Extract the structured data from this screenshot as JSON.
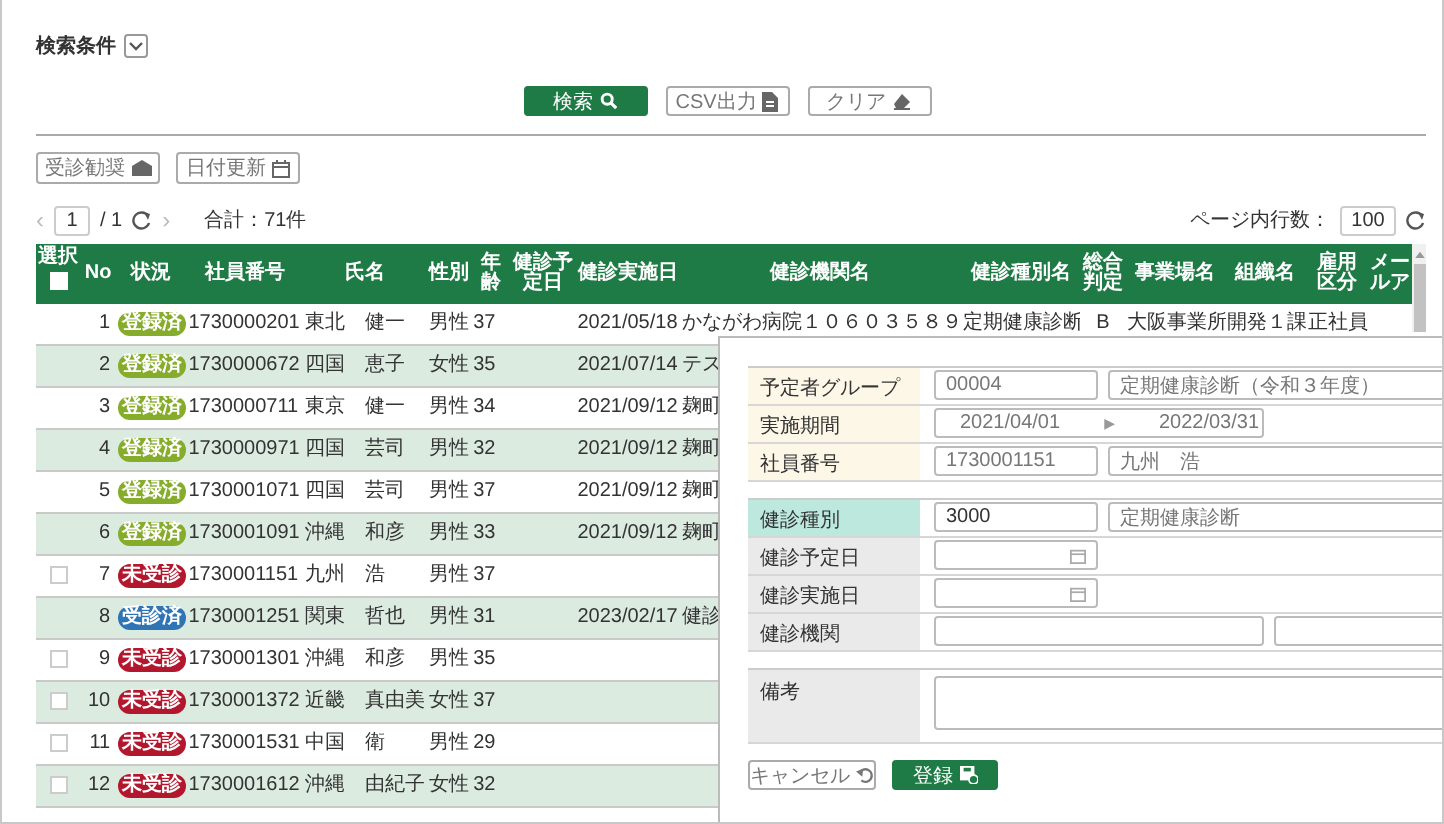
{
  "search_conditions": {
    "label": "検索条件",
    "expanded": false
  },
  "actions": [
    {
      "label": "検索",
      "kind": "search"
    },
    {
      "label": "CSV出力",
      "kind": "csv"
    },
    {
      "label": "クリア",
      "kind": "clear"
    }
  ],
  "tools": [
    {
      "label": "受診勧奨",
      "kind": "mail"
    },
    {
      "label": "日付更新",
      "kind": "calendar"
    }
  ],
  "pagination": {
    "prev": "‹",
    "page": "1",
    "total_pages": "/ 1",
    "next": "›",
    "total": "合計：71件",
    "rows_label": "ページ内行数：",
    "rows_per_page": "100"
  },
  "table": {
    "select_all": {
      "label": "選択",
      "checked": false
    },
    "columns": [
      "No",
      "状況",
      "社員番号",
      "氏名",
      "性別",
      "年齢",
      "健診予定日",
      "健診実施日",
      "健診機関名",
      "健診種別名",
      "総合判定",
      "事業場名",
      "組織名",
      "雇用区分",
      "メールア"
    ],
    "rows": [
      {
        "no": "1",
        "status": {
          "label": "登録済",
          "color": "#86ac2c"
        },
        "id": "1730000201",
        "name": "東北　健一",
        "gender": "男性",
        "age": "37",
        "exam_date": "2021/05/18",
        "clinic": "かながわ病院１０６０３５８９",
        "exam_type": "定期健康診断",
        "judgement": "B",
        "site": "大阪事業所",
        "org": "開発１課",
        "employment": "正社員"
      },
      {
        "no": "2",
        "status": {
          "label": "登録済",
          "color": "#86ac2c"
        },
        "id": "1730000672",
        "name": "四国　恵子",
        "gender": "女性",
        "age": "35",
        "exam_date": "2021/07/14",
        "clinic": "テス"
      },
      {
        "no": "3",
        "status": {
          "label": "登録済",
          "color": "#86ac2c"
        },
        "id": "1730000711",
        "name": "東京　健一",
        "gender": "男性",
        "age": "34",
        "exam_date": "2021/09/12",
        "clinic": "麹町"
      },
      {
        "no": "4",
        "status": {
          "label": "登録済",
          "color": "#86ac2c"
        },
        "id": "1730000971",
        "name": "四国　芸司",
        "gender": "男性",
        "age": "32",
        "exam_date": "2021/09/12",
        "clinic": "麹町"
      },
      {
        "no": "5",
        "status": {
          "label": "登録済",
          "color": "#86ac2c"
        },
        "id": "1730001071",
        "name": "四国　芸司",
        "gender": "男性",
        "age": "37",
        "exam_date": "2021/09/12",
        "clinic": "麹町"
      },
      {
        "no": "6",
        "status": {
          "label": "登録済",
          "color": "#86ac2c"
        },
        "id": "1730001091",
        "name": "沖縄　和彦",
        "gender": "男性",
        "age": "33",
        "exam_date": "2021/09/12",
        "clinic": "麹町"
      },
      {
        "no": "7",
        "status": {
          "label": "未受診",
          "color": "#b3172e"
        },
        "checkbox": {
          "checked": false
        },
        "id": "1730001151",
        "name": "九州　浩",
        "gender": "男性",
        "age": "37"
      },
      {
        "no": "8",
        "status": {
          "label": "受診済",
          "color": "#2f74b5"
        },
        "id": "1730001251",
        "name": "関東　哲也",
        "gender": "男性",
        "age": "31",
        "exam_date": "2023/02/17",
        "clinic": "健診"
      },
      {
        "no": "9",
        "status": {
          "label": "未受診",
          "color": "#b3172e"
        },
        "checkbox": {
          "checked": false
        },
        "id": "1730001301",
        "name": "沖縄　和彦",
        "gender": "男性",
        "age": "35"
      },
      {
        "no": "10",
        "status": {
          "label": "未受診",
          "color": "#b3172e"
        },
        "checkbox": {
          "checked": false
        },
        "id": "1730001372",
        "name": "近畿　真由美",
        "gender": "女性",
        "age": "37"
      },
      {
        "no": "11",
        "status": {
          "label": "未受診",
          "color": "#b3172e"
        },
        "checkbox": {
          "checked": false
        },
        "id": "1730001531",
        "name": "中国　衛",
        "gender": "男性",
        "age": "29"
      },
      {
        "no": "12",
        "status": {
          "label": "未受診",
          "color": "#b3172e"
        },
        "checkbox": {
          "checked": false
        },
        "id": "1730001612",
        "name": "沖縄　由紀子",
        "gender": "女性",
        "age": "32"
      }
    ]
  },
  "form": {
    "groups": [
      [
        {
          "label": {
            "text": "予定者グループ",
            "kind": "fixed"
          },
          "kind": "pair",
          "fields": [
            {
              "value": "00004",
              "disabled": true
            },
            {
              "value": "定期健康診断（令和３年度）",
              "disabled": true
            }
          ]
        },
        {
          "label": {
            "text": "実施期間",
            "kind": "fixed"
          },
          "kind": "range",
          "separator": "▶",
          "fields": [
            {
              "value": "2021/04/01",
              "disabled": true
            },
            {
              "value": "2022/03/31",
              "disabled": true
            }
          ]
        },
        {
          "label": {
            "text": "社員番号",
            "kind": "fixed"
          },
          "kind": "pair",
          "fields": [
            {
              "value": "1730001151",
              "disabled": true
            },
            {
              "value": "九州　浩",
              "disabled": true
            }
          ]
        }
      ],
      [
        {
          "label": {
            "text": "健診種別",
            "kind": "key"
          },
          "kind": "pair",
          "fields": [
            {
              "value": "3000",
              "disabled": false
            },
            {
              "value": "定期健康診断",
              "disabled": true
            }
          ]
        },
        {
          "label": {
            "text": "健診予定日",
            "kind": "edit"
          },
          "kind": "date"
        },
        {
          "label": {
            "text": "健診実施日",
            "kind": "edit"
          },
          "kind": "date"
        },
        {
          "label": {
            "text": "健診機関",
            "kind": "edit"
          },
          "kind": "wide"
        }
      ],
      [
        {
          "label": {
            "text": "備考",
            "kind": "edit"
          },
          "kind": "textarea"
        }
      ]
    ],
    "buttons": [
      {
        "label": "キャンセル",
        "kind": "cancel"
      },
      {
        "label": "登録",
        "kind": "submit"
      }
    ]
  }
}
